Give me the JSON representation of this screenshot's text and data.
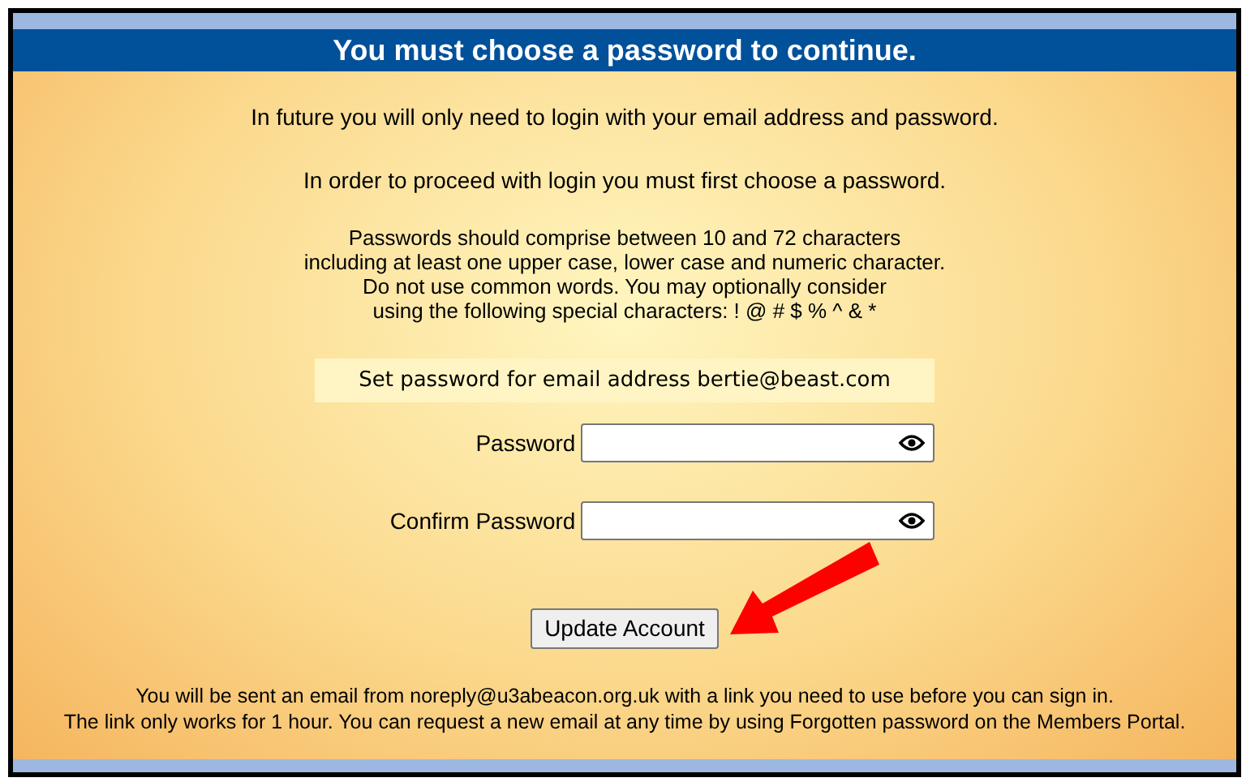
{
  "header": {
    "title": "You must choose a password to continue."
  },
  "intro": [
    "In future you will only need to login with your email address and password.",
    "In order to proceed with login you must first choose a password."
  ],
  "rules": [
    "Passwords should comprise between 10 and 72 characters",
    "including at least one upper case, lower case and numeric character.",
    "Do not use common words. You may optionally consider",
    "using the following special characters: ! @ # $ % ^ & *"
  ],
  "email_notice": "Set password for email address bertie@beast.com",
  "fields": [
    {
      "label": "Password"
    },
    {
      "label": "Confirm Password"
    }
  ],
  "button": "Update Account",
  "footer": [
    "You will be sent an email from noreply@u3abeacon.org.uk with a link you need to use before you can sign in.",
    "The link only works for 1 hour. You can request a new email at any time by using Forgotten password on the Members Portal."
  ]
}
